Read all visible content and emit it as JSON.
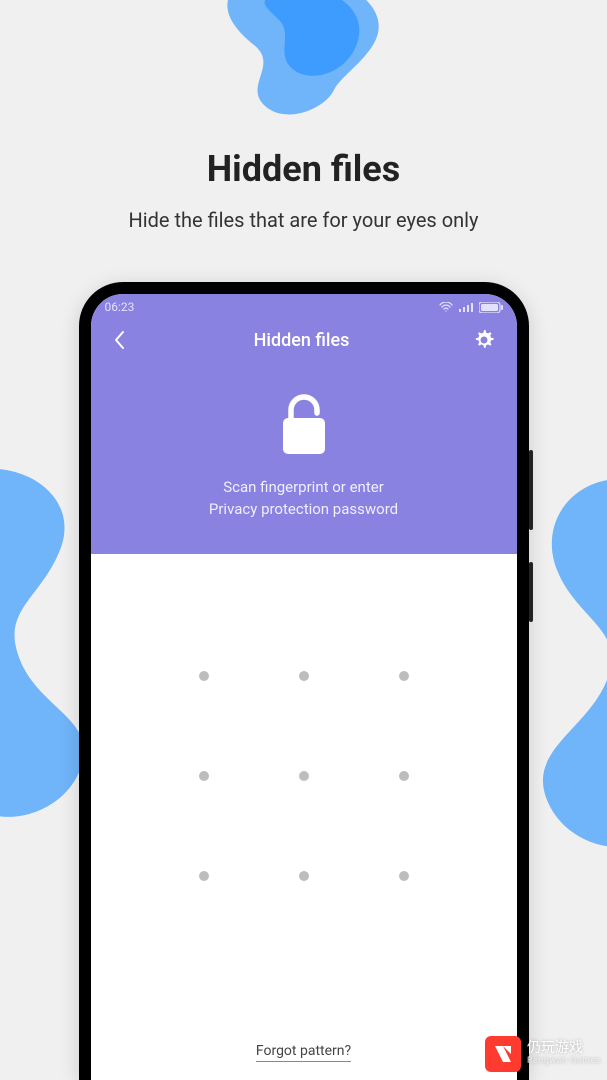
{
  "heading": {
    "title": "Hidden files",
    "subtitle": "Hide the files that are for your eyes only"
  },
  "status": {
    "time": "06:23"
  },
  "header": {
    "title": "Hidden files"
  },
  "lock": {
    "line1": "Scan fingerprint or enter",
    "line2": "Privacy protection password"
  },
  "forgot_label": "Forgot pattern?",
  "watermark": {
    "cn": "仍玩游戏",
    "en": "Rengwan Games"
  }
}
